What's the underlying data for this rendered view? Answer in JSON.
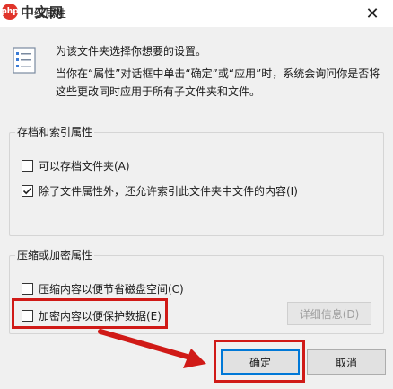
{
  "window": {
    "title": "级属性",
    "watermark_badge": "php",
    "watermark_text": "中文网",
    "close_glyph": "✕"
  },
  "intro": {
    "icon": "settings-list-icon",
    "line1": "为该文件夹选择你想要的设置。",
    "line2": "当你在“属性”对话框中单击“确定”或“应用”时，系统会询问你是否将这些更改同时应用于所有子文件夹和文件。"
  },
  "archive_group": {
    "title": "存档和索引属性",
    "options": [
      {
        "label": "可以存档文件夹(A)",
        "checked": false
      },
      {
        "label": "除了文件属性外，还允许索引此文件夹中文件的内容(I)",
        "checked": true
      }
    ]
  },
  "compress_group": {
    "title": "压缩或加密属性",
    "options": [
      {
        "label": "压缩内容以便节省磁盘空间(C)",
        "checked": false
      },
      {
        "label": "加密内容以便保护数据(E)",
        "checked": false
      }
    ],
    "details_button": "详细信息(D)"
  },
  "buttons": {
    "ok": "确定",
    "cancel": "取消"
  },
  "colors": {
    "highlight": "#d01a17",
    "focus": "#0078d7"
  }
}
